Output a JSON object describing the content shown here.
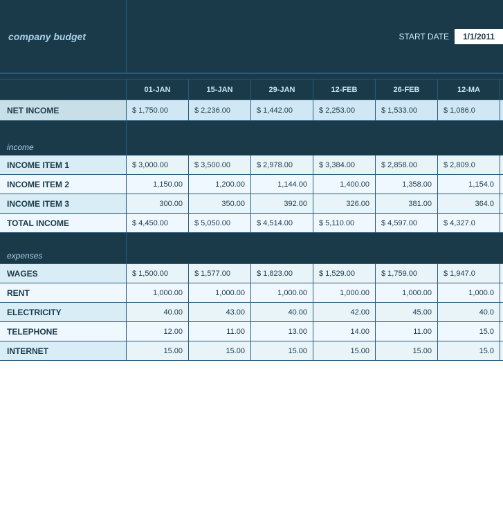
{
  "header": {
    "company_budget": "company budget",
    "start_date_label": "START DATE",
    "start_date_value": "1/1/2011"
  },
  "columns": [
    "01-JAN",
    "15-JAN",
    "29-JAN",
    "12-FEB",
    "26-FEB",
    "12-MA"
  ],
  "net_income": {
    "label": "NET INCOME",
    "values": [
      "$ 1,750.00",
      "$ 2,236.00",
      "$ 1,442.00",
      "$ 2,253.00",
      "$ 1,533.00",
      "$ 1,086.0"
    ]
  },
  "sections": {
    "income": {
      "label": "income",
      "items": [
        {
          "label": "INCOME ITEM 1",
          "values": [
            "$ 3,000.00",
            "$ 3,500.00",
            "$ 2,978.00",
            "$ 3,384.00",
            "$ 2,858.00",
            "$ 2,809.0"
          ],
          "dollar": true
        },
        {
          "label": "INCOME ITEM 2",
          "values": [
            "1,150.00",
            "1,200.00",
            "1,144.00",
            "1,400.00",
            "1,358.00",
            "1,154.0"
          ],
          "dollar": false
        },
        {
          "label": "INCOME ITEM 3",
          "values": [
            "300.00",
            "350.00",
            "392.00",
            "326.00",
            "381.00",
            "364.0"
          ],
          "dollar": false
        },
        {
          "label": "TOTAL INCOME",
          "values": [
            "$ 4,450.00",
            "$ 5,050.00",
            "$ 4,514.00",
            "$ 5,110.00",
            "$ 4,597.00",
            "$ 4,327.0"
          ],
          "dollar": true
        }
      ]
    },
    "expenses": {
      "label": "expenses",
      "items": [
        {
          "label": "WAGES",
          "values": [
            "$ 1,500.00",
            "$ 1,577.00",
            "$ 1,823.00",
            "$ 1,529.00",
            "$ 1,759.00",
            "$ 1,947.0"
          ],
          "dollar": true
        },
        {
          "label": "RENT",
          "values": [
            "1,000.00",
            "1,000.00",
            "1,000.00",
            "1,000.00",
            "1,000.00",
            "1,000.0"
          ],
          "dollar": false
        },
        {
          "label": "ELECTRICITY",
          "values": [
            "40.00",
            "43.00",
            "40.00",
            "42.00",
            "45.00",
            "40.0"
          ],
          "dollar": false
        },
        {
          "label": "TELEPHONE",
          "values": [
            "12.00",
            "11.00",
            "13.00",
            "14.00",
            "11.00",
            "15.0"
          ],
          "dollar": false
        },
        {
          "label": "INTERNET",
          "values": [
            "15.00",
            "15.00",
            "15.00",
            "15.00",
            "15.00",
            "15.0"
          ],
          "dollar": false
        }
      ]
    }
  }
}
